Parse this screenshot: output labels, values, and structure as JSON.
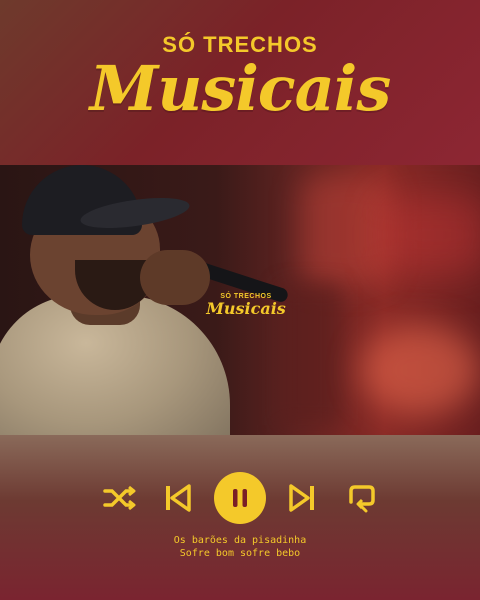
{
  "brand": {
    "top_text": "SÓ TRECHOS",
    "main_text": "Musicais",
    "watermark_top": "SÓ TRECHOS",
    "watermark_main": "Musicais"
  },
  "player": {
    "shuffle_icon": "shuffle-icon",
    "previous_icon": "skip-previous-icon",
    "pause_icon": "pause-icon",
    "next_icon": "skip-next-icon",
    "repeat_icon": "repeat-one-icon",
    "accent_color": "#f4c92a"
  },
  "track": {
    "artist": "Os barões da pisadinha",
    "title": "Sofre bom sofre bebo"
  }
}
